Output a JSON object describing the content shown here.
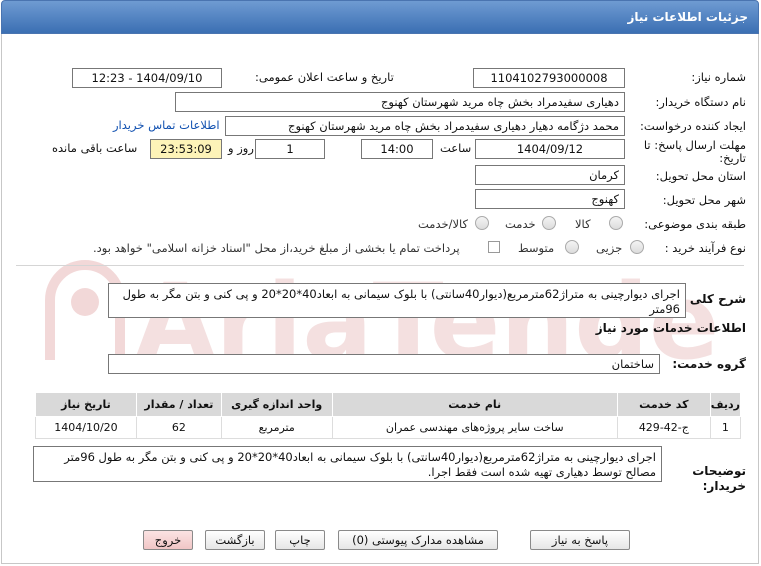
{
  "page": {
    "title": "جزئیات اطلاعات نیاز"
  },
  "form": {
    "need_number": {
      "label": "شماره نیاز:",
      "value": "1104102793000008"
    },
    "announce": {
      "label": "تاریخ و ساعت اعلان عمومی:",
      "value": "1404/09/10 - 12:23"
    },
    "buyer": {
      "label": "نام دستگاه خریدار:",
      "value": "دهیاری سفیدمراد بخش چاه مرید شهرستان کهنوج"
    },
    "creator": {
      "label": "ایجاد کننده درخواست:",
      "value": "محمد دژگامه دهیار دهیاری سفیدمراد بخش چاه مرید شهرستان کهنوج",
      "contact_link": "اطلاعات تماس خریدار"
    },
    "deadline": {
      "label_line1": "مهلت ارسال پاسخ: تا",
      "label_line2": "تاریخ:",
      "date": "1404/09/12",
      "time_label": "ساعت",
      "time": "14:00",
      "days": "1",
      "days_label": "روز و",
      "remaining": "23:53:09",
      "remaining_label": "ساعت باقی مانده"
    },
    "province": {
      "label": "استان محل تحویل:",
      "value": "کرمان"
    },
    "city": {
      "label": "شهر محل تحویل:",
      "value": "کهنوج"
    },
    "category": {
      "label": "طبقه بندی موضوعی:",
      "options": [
        "کالا",
        "خدمت",
        "کالا/خدمت"
      ]
    },
    "process": {
      "label": "نوع فرآیند خرید :",
      "options": [
        "جزیی",
        "متوسط"
      ],
      "payment_note": "پرداخت تمام یا بخشی از مبلغ خرید،از محل \"اسناد خزانه اسلامی\" خواهد بود."
    }
  },
  "summary": {
    "label": "شرح کلی نیاز:",
    "text": "اجرای دیوارچینی به متراژ62مترمربع(دیوار40سانتی) با بلوک سیمانی به ابعاد40*20*20 و پی کنی و بتن مگر به طول 96متر"
  },
  "services": {
    "title": "اطلاعات خدمات مورد نیاز",
    "group_label": "گروه خدمت:",
    "group_value": "ساختمان",
    "columns": [
      "ردیف",
      "کد خدمت",
      "نام خدمت",
      "واحد اندازه گیری",
      "تعداد / مقدار",
      "تاریخ نیاز"
    ],
    "rows": [
      [
        "1",
        "ج-42-429",
        "ساخت سایر پروژه‌های مهندسی عمران",
        "مترمربع",
        "62",
        "1404/10/20"
      ]
    ]
  },
  "buyer_notes": {
    "label_line1": "توضیحات",
    "label_line2": "خریدار:",
    "text": "اجرای دیوارچینی به متراژ62مترمربع(دیوار40سانتی) با بلوک سیمانی به ابعاد40*20*20 و پی کنی و بتن مگر به طول 96متر مصالح توسط دهیاری تهیه شده است فقط اجرا."
  },
  "buttons": {
    "reply": "پاسخ به نیاز",
    "docs": "مشاهده مدارک پیوستی (0)",
    "print": "چاپ",
    "back": "بازگشت",
    "exit": "خروج"
  },
  "watermark": {
    "text": "AriaTender.net"
  },
  "colors": {
    "title_bar": "#3b6fb3",
    "link": "#1050b0",
    "remaining_bg": "#fdf3b8",
    "exit_bg": "#f1c6c6",
    "watermark": "#e6b3b3"
  }
}
